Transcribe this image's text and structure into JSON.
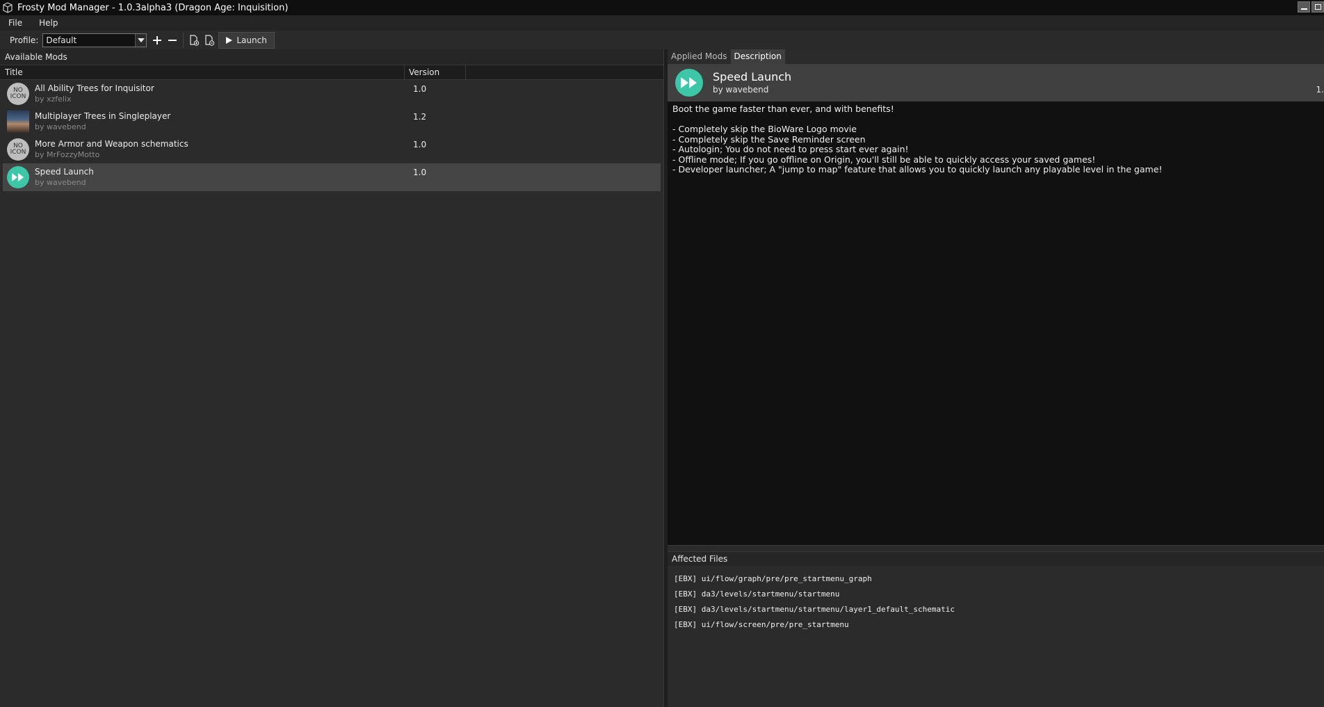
{
  "window": {
    "title": "Frosty Mod Manager - 1.0.3alpha3 (Dragon Age: Inquisition)"
  },
  "menu": [
    "File",
    "Help"
  ],
  "toolbar": {
    "profile_label": "Profile:",
    "profile_value": "Default",
    "launch_label": "Launch"
  },
  "available_mods": {
    "header": "Available Mods",
    "columns": {
      "title": "Title",
      "version": "Version"
    },
    "mods": [
      {
        "title": "All Ability Trees for Inquisitor",
        "author": "by xzfelix",
        "version": "1.0",
        "icon": "no-icon"
      },
      {
        "title": "Multiplayer Trees in Singleplayer",
        "author": "by wavebend",
        "version": "1.2",
        "icon": "photo"
      },
      {
        "title": "More Armor and Weapon schematics",
        "author": "by MrFozzyMotto",
        "version": "1.0",
        "icon": "no-icon"
      },
      {
        "title": "Speed Launch",
        "author": "by wavebend",
        "version": "1.0",
        "icon": "speed-launch"
      }
    ],
    "noicon_text": [
      "NO",
      "ICON"
    ]
  },
  "right_tabs": [
    "Applied Mods",
    "Description"
  ],
  "description": {
    "title": "Speed Launch",
    "author": "by wavebend",
    "version": "1.",
    "lines": [
      "Boot the game faster than ever, and with benefits!",
      "",
      "- Completely skip the BioWare Logo movie",
      "- Completely skip the Save Reminder screen",
      "- Autologin; You do not need to press start ever again!",
      "- Offline mode; If you go offline on Origin, you'll still be able to quickly access your saved games!",
      "- Developer launcher; A \"jump to map\" feature that allows you to quickly launch any playable level in the game!"
    ]
  },
  "affected_files": {
    "header": "Affected Files",
    "files": [
      "[EBX] ui/flow/graph/pre/pre_startmenu_graph",
      "[EBX] da3/levels/startmenu/startmenu",
      "[EBX] da3/levels/startmenu/startmenu/layer1_default_schematic",
      "[EBX] ui/flow/screen/pre/pre_startmenu"
    ]
  },
  "colors": {
    "accent_teal": "#3ec6a8",
    "selected_row": "#454545"
  }
}
